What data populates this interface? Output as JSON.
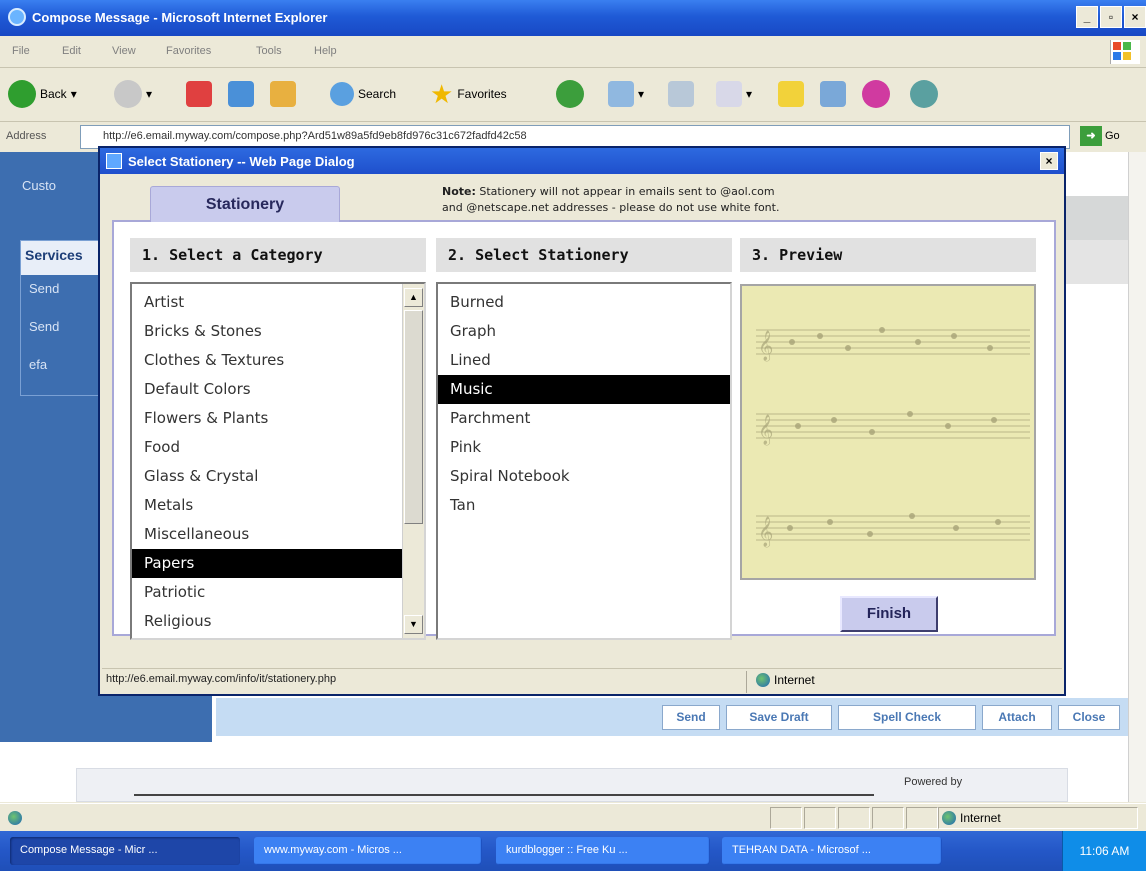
{
  "ie": {
    "title": "Compose Message - Microsoft Internet Explorer",
    "menu": [
      "File",
      "Edit",
      "View",
      "Favorites",
      "Tools",
      "Help"
    ],
    "back_label": "Back",
    "search_label": "Search",
    "favorites_label": "Favorites",
    "address_label": "Address",
    "address_url": "http://e6.email.myway.com/compose.php?Ard51w89a5fd9eb8fd976c31c672fadfd42c58",
    "go_label": "Go",
    "status_zone": "Internet"
  },
  "background_page": {
    "left_item": "Custo",
    "services_header": "Services",
    "services_items": [
      "Send",
      "Send",
      "efa"
    ],
    "compose_buttons": [
      "Send",
      "Save Draft",
      "Spell Check",
      "Attach",
      "Close"
    ],
    "powered_by": "Powered by"
  },
  "dialog": {
    "title": "Select Stationery -- Web Page Dialog",
    "tab_label": "Stationery",
    "note_bold": "Note:",
    "note_line1": " Stationery will not appear in emails sent to @aol.com",
    "note_line2": "and @netscape.net addresses - please do not use white font.",
    "col1_header": "1. Select a Category",
    "col2_header": "2. Select Stationery",
    "col3_header": "3. Preview",
    "categories": [
      "Artist",
      "Bricks & Stones",
      "Clothes & Textures",
      "Default Colors",
      "Flowers & Plants",
      "Food",
      "Glass & Crystal",
      "Metals",
      "Miscellaneous",
      "Papers",
      "Patriotic",
      "Religious"
    ],
    "selected_category": "Papers",
    "stationery": [
      "Burned",
      "Graph",
      "Lined",
      "Music",
      "Parchment",
      "Pink",
      "Spiral Notebook",
      "Tan"
    ],
    "selected_stationery": "Music",
    "finish_label": "Finish",
    "status_url": "http://e6.email.myway.com/info/it/stationery.php",
    "status_zone": "Internet"
  },
  "taskbar": {
    "tasks": [
      "Compose Message - Micr ...",
      "www.myway.com - Micros ...",
      "kurdblogger :: Free Ku ...",
      "TEHRAN DATA - Microsof ..."
    ],
    "clock": "11:06 AM"
  },
  "colors": {
    "xp_blue": "#2457c7",
    "dialog_tab": "#c9cbed",
    "preview_paper": "#ebe9b3",
    "selection": "#000000"
  }
}
